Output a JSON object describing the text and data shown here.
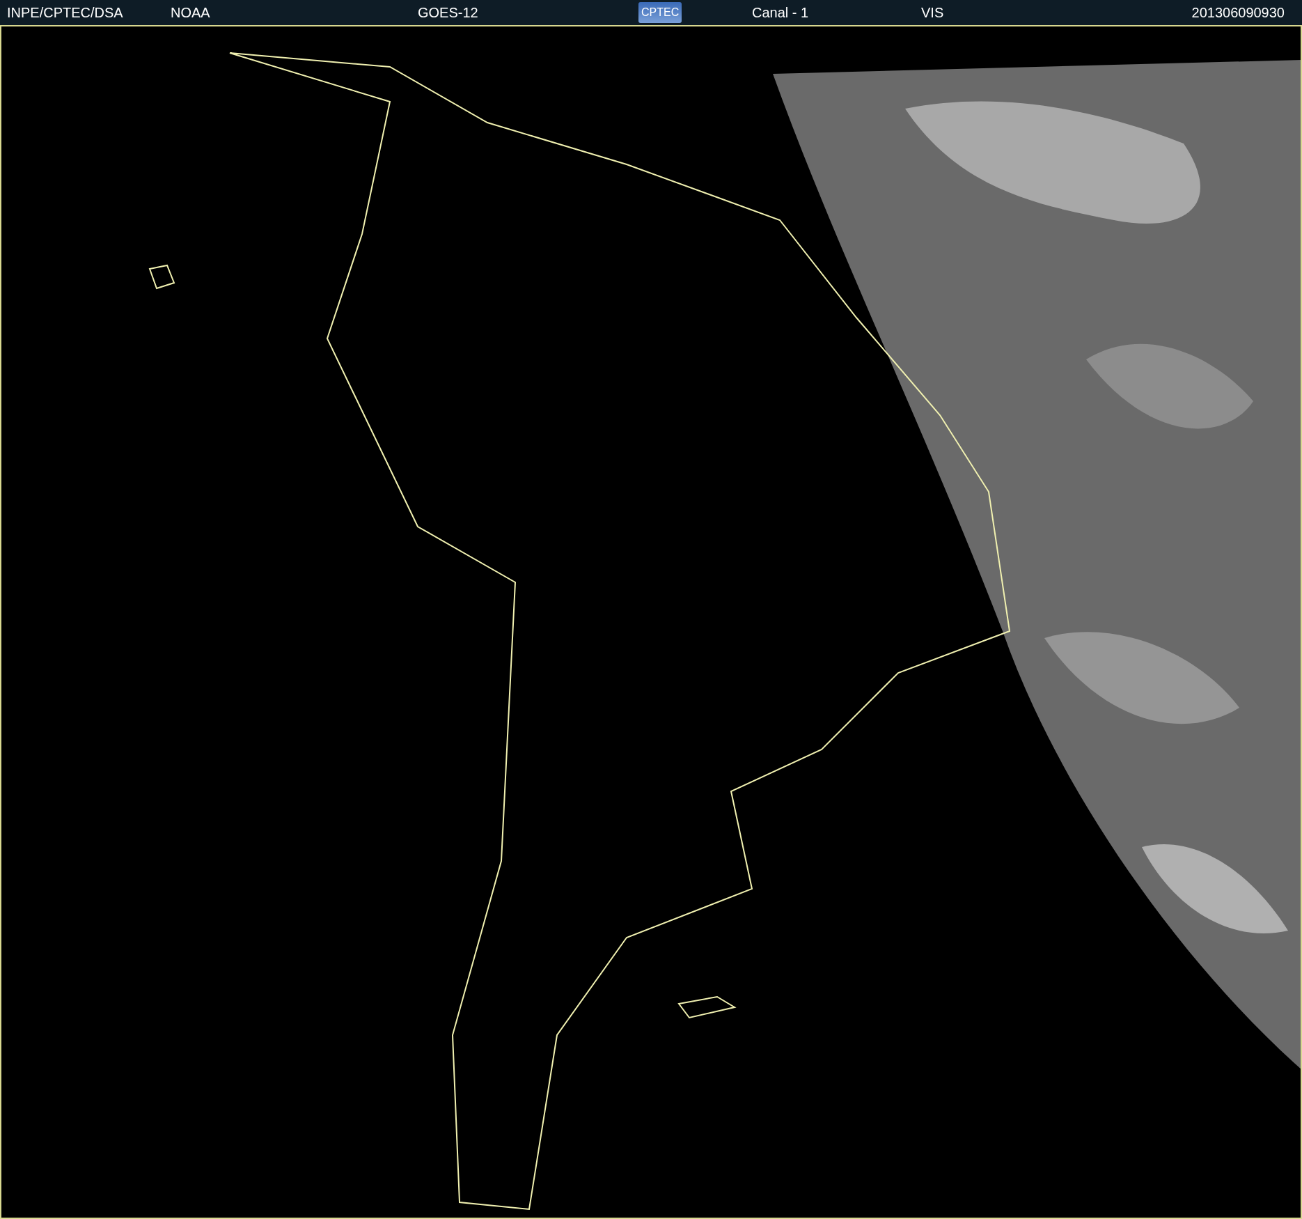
{
  "header": {
    "source": "INPE/CPTEC/DSA",
    "agency": "NOAA",
    "satellite": "GOES-12",
    "logo_text": "CPTEC",
    "channel": "Canal - 1",
    "band": "VIS",
    "timestamp": "201306090930"
  }
}
